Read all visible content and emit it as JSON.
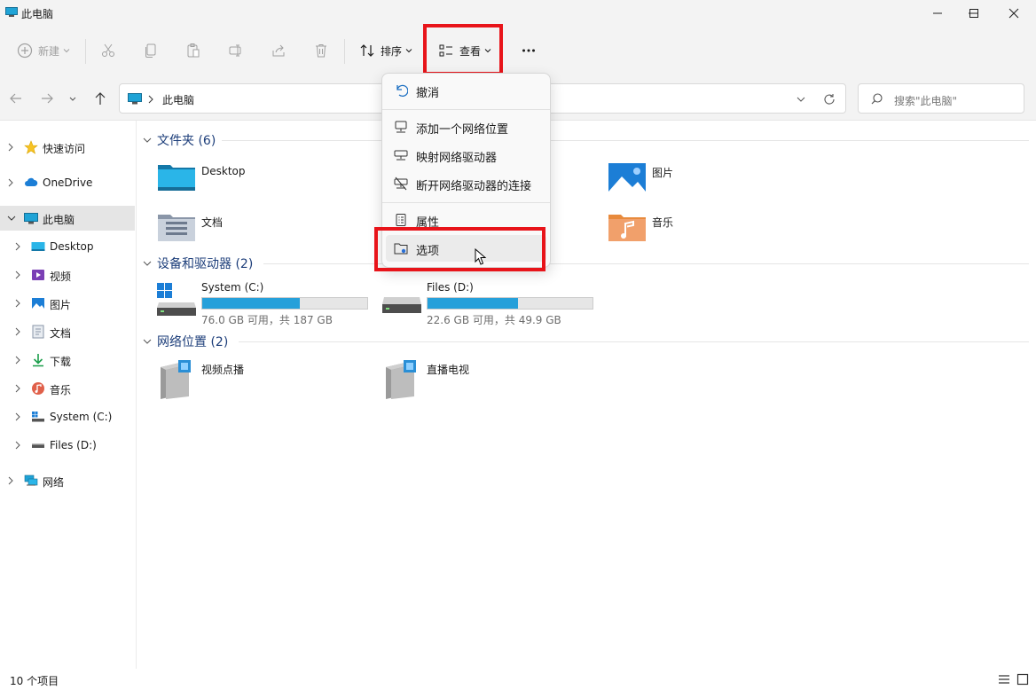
{
  "window": {
    "title": "此电脑",
    "controls": [
      "minimize",
      "maximize",
      "close"
    ]
  },
  "toolbar": {
    "new_label": "新建",
    "sort_label": "排序",
    "view_label": "查看",
    "more_label": "...",
    "icons": [
      "new-icon",
      "cut-icon",
      "copy-icon",
      "paste-icon",
      "rename-icon",
      "share-icon",
      "delete-icon",
      "sort-icon",
      "view-icon",
      "more-icon"
    ]
  },
  "navigation": {
    "address_text": "此电脑",
    "search_placeholder": "搜索\"此电脑\""
  },
  "sidebar": {
    "items": [
      {
        "label": "快速访问",
        "icon": "star-icon"
      },
      {
        "label": "OneDrive",
        "icon": "cloud-icon"
      },
      {
        "label": "此电脑",
        "icon": "computer-icon",
        "selected": true
      },
      {
        "label": "Desktop",
        "icon": "desktop-icon"
      },
      {
        "label": "视频",
        "icon": "videos-icon"
      },
      {
        "label": "图片",
        "icon": "pictures-icon"
      },
      {
        "label": "文档",
        "icon": "documents-icon"
      },
      {
        "label": "下载",
        "icon": "download-icon"
      },
      {
        "label": "音乐",
        "icon": "music-icon"
      },
      {
        "label": "System (C:)",
        "icon": "system-drive-icon"
      },
      {
        "label": "Files (D:)",
        "icon": "drive-icon"
      },
      {
        "label": "网络",
        "icon": "network-icon"
      }
    ]
  },
  "content": {
    "groups": [
      {
        "title": "文件夹 (6)"
      },
      {
        "title": "设备和驱动器 (2)"
      },
      {
        "title": "网络位置 (2)"
      }
    ],
    "folders": [
      {
        "label": "Desktop",
        "icon": "desktop-folder-icon"
      },
      {
        "label": "图片",
        "icon": "pictures-folder-icon"
      },
      {
        "label": "文档",
        "icon": "documents-folder-icon"
      },
      {
        "label": "音乐",
        "icon": "music-folder-icon"
      }
    ],
    "drives": [
      {
        "name": "System (C:)",
        "info": "76.0 GB 可用，共 187 GB",
        "used_fraction": 0.594,
        "icon": "windows-drive-icon"
      },
      {
        "name": "Files (D:)",
        "info": "22.6 GB 可用，共 49.9 GB",
        "used_fraction": 0.547,
        "icon": "hard-drive-icon"
      }
    ],
    "network_locations": [
      {
        "label": "视频点播",
        "icon": "network-location-icon"
      },
      {
        "label": "直播电视",
        "icon": "network-location-icon"
      }
    ]
  },
  "view_menu": {
    "items": [
      {
        "label": "撤消",
        "icon": "undo-icon"
      },
      {
        "label": "添加一个网络位置",
        "icon": "add-network-location-icon"
      },
      {
        "label": "映射网络驱动器",
        "icon": "map-drive-icon"
      },
      {
        "label": "断开网络驱动器的连接",
        "icon": "disconnect-drive-icon"
      },
      {
        "label": "属性",
        "icon": "properties-icon"
      },
      {
        "label": "选项",
        "icon": "options-icon",
        "hovered": true
      }
    ]
  },
  "status": {
    "item_count": "10 个项目"
  },
  "colors": {
    "highlight_box": "#e8141a",
    "drive_fill": "#26a0da",
    "group_title": "#1d3e7a",
    "chrome_bg": "#f3f3f3"
  }
}
